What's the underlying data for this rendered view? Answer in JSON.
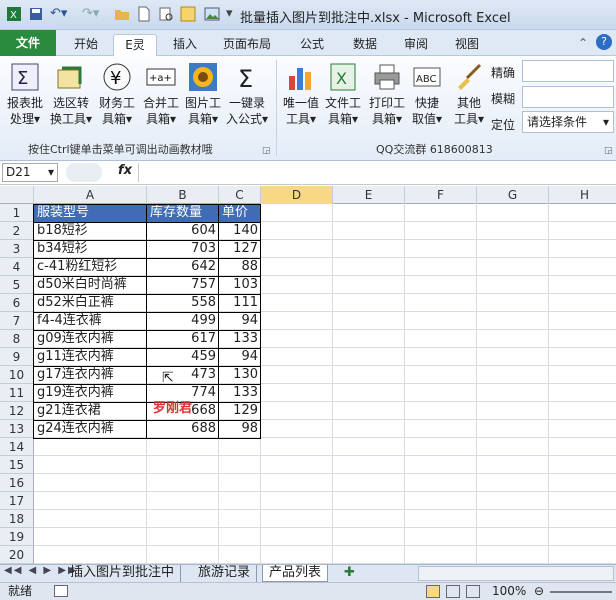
{
  "window": {
    "title": "批量插入图片到批注中.xlsx  -  Microsoft Excel"
  },
  "ribbon_tabs": [
    "开始",
    "E灵",
    "插入",
    "页面布局",
    "公式",
    "数据",
    "审阅",
    "视图"
  ],
  "file_tab": "文件",
  "ribbon": {
    "buttons": [
      {
        "line1": "报表批",
        "line2": "处理▾",
        "icon": "report-batch-icon"
      },
      {
        "line1": "选区转",
        "line2": "换工具▾",
        "icon": "range-convert-icon"
      },
      {
        "line1": "财务工",
        "line2": "具箱▾",
        "icon": "yen-finance-icon"
      },
      {
        "line1": "合并工",
        "line2": "具箱▾",
        "icon": "merge-tools-icon"
      },
      {
        "line1": "图片工",
        "line2": "具箱▾",
        "icon": "sunflower-picture-icon"
      },
      {
        "line1": "一键录",
        "line2": "入公式▾",
        "icon": "sigma-formula-icon"
      },
      {
        "line1": "唯一值",
        "line2": "工具▾",
        "icon": "bar-chart-icon"
      },
      {
        "line1": "文件工",
        "line2": "具箱▾",
        "icon": "excel-file-icon"
      },
      {
        "line1": "打印工",
        "line2": "具箱▾",
        "icon": "printer-icon"
      },
      {
        "line1": "快捷",
        "line2": "取值▾",
        "icon": "abc-icon"
      },
      {
        "line1": "其他",
        "line2": "工具▾",
        "icon": "broom-icon"
      }
    ],
    "small_buttons": [
      "精确",
      "模糊",
      "定位"
    ],
    "combo": "请选择条件",
    "group1_label": "按住Ctrl键单击菜单可调出动画教材哦",
    "group2_label": "QQ交流群  618600813"
  },
  "formula_bar": {
    "name_box": "D21",
    "fx": "fx",
    "formula": ""
  },
  "columns": [
    "A",
    "B",
    "C",
    "D",
    "E",
    "F",
    "G",
    "H"
  ],
  "selected_column": "D",
  "row_numbers": [
    "1",
    "2",
    "3",
    "4",
    "5",
    "6",
    "7",
    "8",
    "9",
    "10",
    "11",
    "12",
    "13",
    "14",
    "15",
    "16",
    "17",
    "18",
    "19",
    "20"
  ],
  "table": {
    "headers": [
      "服装型号",
      "库存数量",
      "单价"
    ],
    "rows": [
      [
        "b18短衫",
        "604",
        "140"
      ],
      [
        "b34短衫",
        "703",
        "127"
      ],
      [
        "c-41粉红短衫",
        "642",
        "88"
      ],
      [
        "d50米白时尚裤",
        "757",
        "103"
      ],
      [
        "d52米白正裤",
        "558",
        "111"
      ],
      [
        "f4-4连衣裤",
        "499",
        "94"
      ],
      [
        "g09连衣内裤",
        "617",
        "133"
      ],
      [
        "g11连衣内裤",
        "459",
        "94"
      ],
      [
        "g17连衣内裤",
        "473",
        "130"
      ],
      [
        "g19连衣内裤",
        "774",
        "133"
      ],
      [
        "g21连衣裙",
        "668",
        "129"
      ],
      [
        "g24连衣内裤",
        "688",
        "98"
      ]
    ]
  },
  "watermark": "罗刚君",
  "sheets": [
    "插入图片到批注中",
    "旅游记录",
    "产品列表"
  ],
  "active_sheet": "产品列表",
  "status": {
    "ready": "就绪",
    "zoom": "100%"
  },
  "colors": {
    "header_fill": "#3f6cb3",
    "file_tab": "#2a8a3e",
    "selected_col": "#f7d983"
  }
}
